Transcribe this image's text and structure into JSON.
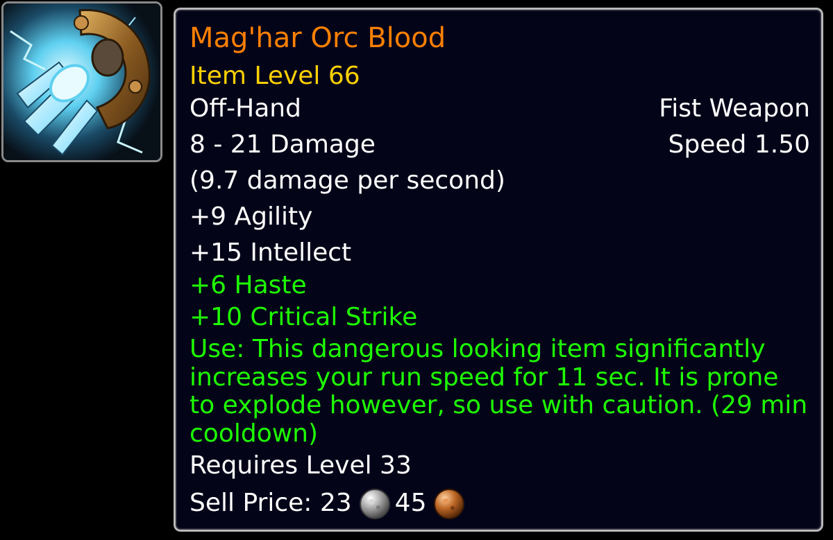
{
  "item": {
    "icon": "fist-weapon-icon",
    "name": "Mag'har Orc Blood",
    "item_level": "Item Level 66",
    "slot": "Off-Hand",
    "weapon_type": "Fist Weapon",
    "damage": "8 - 21 Damage",
    "speed": "Speed 1.50",
    "dps": "(9.7 damage per second)",
    "stats": [
      "+9 Agility",
      "+15 Intellect"
    ],
    "secondary_stats": [
      "+6 Haste",
      "+10 Critical Strike"
    ],
    "use_effect": "Use: This dangerous looking item significantly increases your run speed for 11 sec. It is prone to explode however, so use with caution. (29 min cooldown)",
    "requires": "Requires Level 33",
    "sell_price": {
      "label": "Sell Price:",
      "silver": "23",
      "copper": "45"
    }
  },
  "colors": {
    "legendary_orange": "#ff8000",
    "item_level_yellow": "#ffd100",
    "bonus_green": "#1eff00",
    "tooltip_background": "#040419"
  }
}
